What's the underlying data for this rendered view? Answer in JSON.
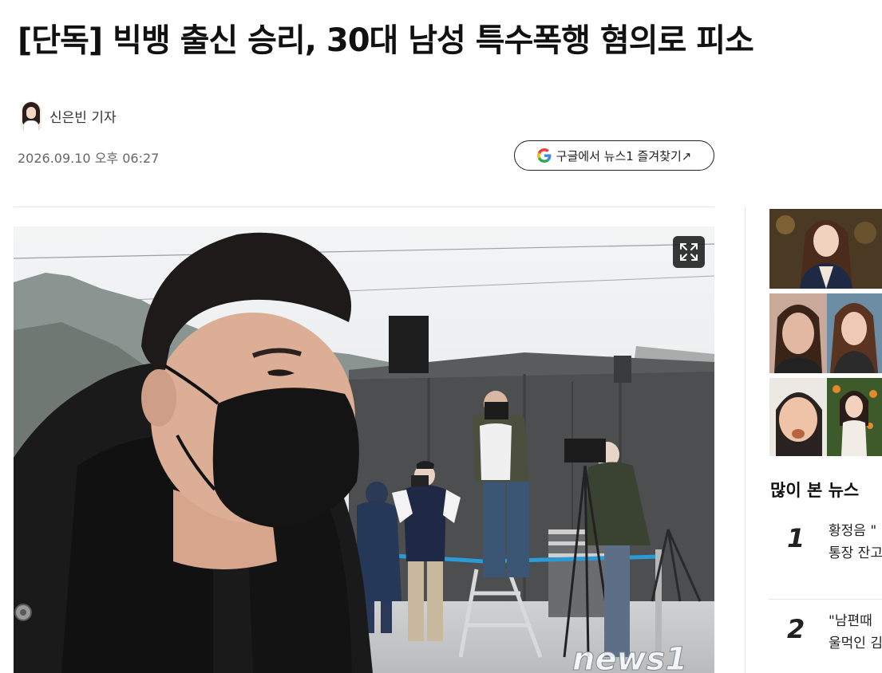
{
  "article": {
    "headline": "[단독] 빅뱅 출신 승리, 30대 남성 특수폭행 혐의로 피소",
    "reporter": "신은빈 기자",
    "date": "2026.09.10 오후 06:27",
    "google_button": "구글에서 뉴스1 즐겨찾기↗",
    "photo_watermark": "news1"
  },
  "sidebar": {
    "popular_title": "많이 본 뉴스",
    "popular_items": [
      {
        "rank": "1",
        "line1": "황정음 \"",
        "line2": "통장 잔고"
      },
      {
        "rank": "2",
        "line1": "\"남편때",
        "line2": "울먹인 김"
      }
    ]
  },
  "colors": {
    "text": "#111111",
    "meta": "#666666",
    "divider": "#e5e5e5",
    "rope": "#2a9bd7"
  },
  "icons": {
    "google": "google-g-icon",
    "expand": "expand-icon"
  }
}
